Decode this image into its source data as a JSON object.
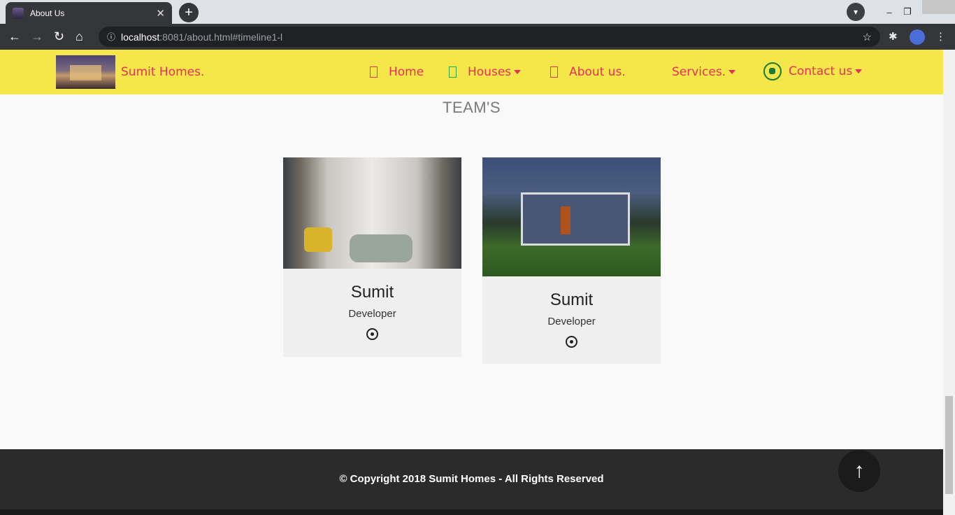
{
  "browser": {
    "tab_title": "About Us",
    "tab_close": "✕",
    "new_tab": "+",
    "url_host": "localhost",
    "url_path": ":8081/about.html#timeline1-l",
    "icons": [
      "back-icon",
      "forward-icon",
      "reload-icon",
      "home-icon",
      "info-icon",
      "star-icon",
      "extensions-icon",
      "profile-icon",
      "menu-icon"
    ]
  },
  "site": {
    "brand": "Sumit Homes.",
    "nav": {
      "home": "Home",
      "houses": "Houses",
      "about": "About us.",
      "services": "Services.",
      "contact": "Contact us"
    },
    "colors": {
      "navbar_bg": "#f5e74a",
      "nav_text": "#e6305a",
      "footer_bg": "#2b2b2b"
    }
  },
  "main": {
    "heading": "TEAM'S",
    "team": [
      {
        "name": "Sumit",
        "role": "Developer"
      },
      {
        "name": "Sumit",
        "role": "Developer"
      }
    ]
  },
  "footer": {
    "copyright": "© Copyright 2018  Sumit Homes - All Rights Reserved"
  }
}
